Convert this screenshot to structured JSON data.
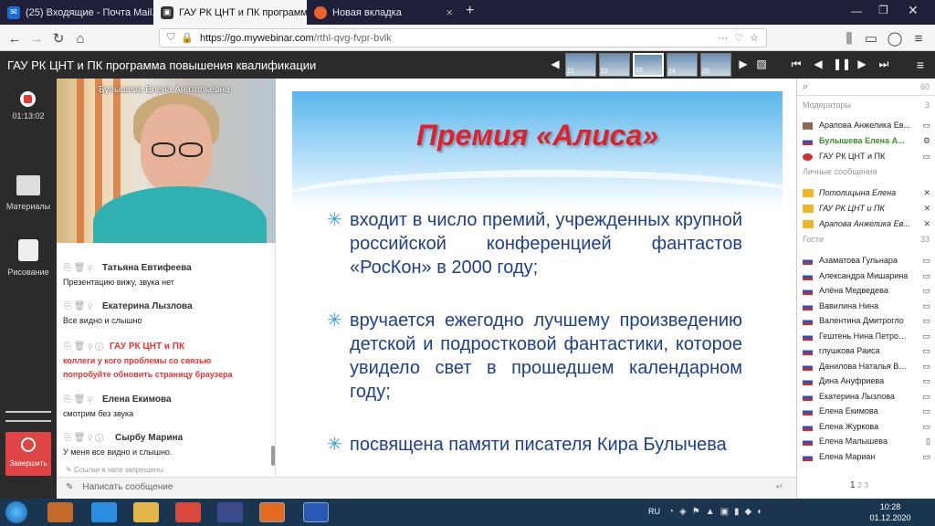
{
  "browser": {
    "tabs": [
      {
        "label": "(25) Входящие - Почта Mail.ru",
        "active": false
      },
      {
        "label": "ГАУ РК ЦНТ и ПК программа",
        "active": true
      },
      {
        "label": "Новая вкладка",
        "active": false
      }
    ],
    "url_host": "https://go.mywebinar.com",
    "url_path": "/rthl-qvg-fvpr-bvlk"
  },
  "app": {
    "title": "ГАУ РК ЦНТ и ПК программа повышения квалификации",
    "timer": "01:13:02",
    "materials_label": "Материалы",
    "drawing_label": "Рисование",
    "stop_label": "Завершить",
    "thumbs": [
      "21",
      "22",
      "23",
      "24",
      "25"
    ]
  },
  "video": {
    "name": "Булышева Елена Анатольевна"
  },
  "chat": {
    "messages": [
      {
        "name": "Татьяна Евтифеева",
        "text": "Презентацию вижу, звука нет",
        "red": false
      },
      {
        "name": "Екатерина Лызлова",
        "text": "Все видно и слышно",
        "red": false
      },
      {
        "name": "ГАУ РК ЦНТ и ПК",
        "text": "коллеги у кого проблемы со связью попробуйте обновить страницу браузера",
        "red": true
      },
      {
        "name": "Елена Екимова",
        "text": "смотрим без звука",
        "red": false
      },
      {
        "name": "Сырбу Марина",
        "text": "У меня все видно и слышно.",
        "red": false
      }
    ],
    "links_note": "Ссылки в чате запрещены",
    "input_placeholder": "Написать сообщение"
  },
  "slide": {
    "title": "Премия «Алиса»",
    "bullets": [
      "входит в число премий, учрежденных крупной российской конференцией фантастов «РосКон» в 2000 году;",
      "вручается ежегодно лучшему произведению детской и подростковой фантастики, которое увидело свет в прошедшем календарном году;",
      "посвящена памяти писателя Кира Булычева"
    ]
  },
  "participants": {
    "search_count": "60",
    "moderators_label": "Модераторы",
    "moderators_count": "3",
    "moderators": [
      "Арапова Анжелика Ев...",
      "Булышева Елена А...",
      "ГАУ РК ЦНТ и ПК"
    ],
    "pm_label": "Личные сообщения",
    "pm": [
      "Потолицына Елена",
      "ГАУ РК ЦНТ и ПК",
      "Арапова Анжелика Ев..."
    ],
    "guests_label": "Гости",
    "guests_count": "33",
    "guests": [
      "Азаматова Гульнара",
      "Александра Мишарина",
      "Алёна Медведева",
      "Вавилина Нина",
      "Валентина Дмитрогло",
      "Гештень Нина Петровна",
      "глушкова Раиса",
      "Данилова Наталья Вас...",
      "Дина Ануфриева",
      "Екатерина Лызлова",
      "Елена Екимова",
      "Елена Журкова",
      "Елена Малышева",
      "Елена Мариан"
    ],
    "pages": [
      "1",
      "2",
      "3"
    ]
  },
  "taskbar": {
    "lang": "RU",
    "time": "10:28",
    "date": "01.12.2020"
  }
}
